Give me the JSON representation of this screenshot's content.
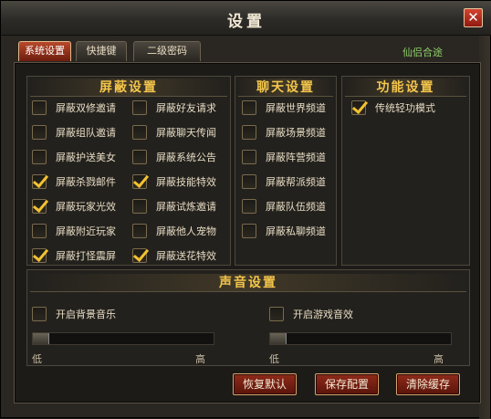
{
  "window": {
    "title": "设置",
    "close_glyph": "✕"
  },
  "background": {
    "label": "仙侣合途"
  },
  "tabs": [
    {
      "label": "系统设置",
      "active": true
    },
    {
      "label": "快捷键",
      "active": false
    },
    {
      "label": "二级密码",
      "active": false
    }
  ],
  "shield": {
    "header": "屏蔽设置",
    "left": [
      {
        "label": "屏蔽双修邀请",
        "checked": false
      },
      {
        "label": "屏蔽组队邀请",
        "checked": false
      },
      {
        "label": "屏蔽护送美女",
        "checked": false
      },
      {
        "label": "屏蔽杀戮邮件",
        "checked": true
      },
      {
        "label": "屏蔽玩家光效",
        "checked": true
      },
      {
        "label": "屏蔽附近玩家",
        "checked": false
      },
      {
        "label": "屏蔽打怪震屏",
        "checked": true
      }
    ],
    "right": [
      {
        "label": "屏蔽好友请求",
        "checked": false
      },
      {
        "label": "屏蔽聊天传闻",
        "checked": false
      },
      {
        "label": "屏蔽系统公告",
        "checked": false
      },
      {
        "label": "屏蔽技能特效",
        "checked": true
      },
      {
        "label": "屏蔽试炼邀请",
        "checked": false
      },
      {
        "label": "屏蔽他人宠物",
        "checked": false
      },
      {
        "label": "屏蔽送花特效",
        "checked": true
      }
    ]
  },
  "chat": {
    "header": "聊天设置",
    "items": [
      {
        "label": "屏蔽世界频道",
        "checked": false
      },
      {
        "label": "屏蔽场景频道",
        "checked": false
      },
      {
        "label": "屏蔽阵营频道",
        "checked": false
      },
      {
        "label": "屏蔽帮派频道",
        "checked": false
      },
      {
        "label": "屏蔽队伍频道",
        "checked": false
      },
      {
        "label": "屏蔽私聊频道",
        "checked": false
      }
    ]
  },
  "function": {
    "header": "功能设置",
    "items": [
      {
        "label": "传统轻功模式",
        "checked": true
      }
    ]
  },
  "sound": {
    "header": "声音设置",
    "bgm": {
      "label": "开启背景音乐",
      "checked": false,
      "low": "低",
      "high": "高",
      "level": 0
    },
    "sfx": {
      "label": "开启游戏音效",
      "checked": false,
      "low": "低",
      "high": "高",
      "level": 0
    }
  },
  "buttons": {
    "restore": "恢复默认",
    "save": "保存配置",
    "clear_cache": "清除缓存"
  }
}
